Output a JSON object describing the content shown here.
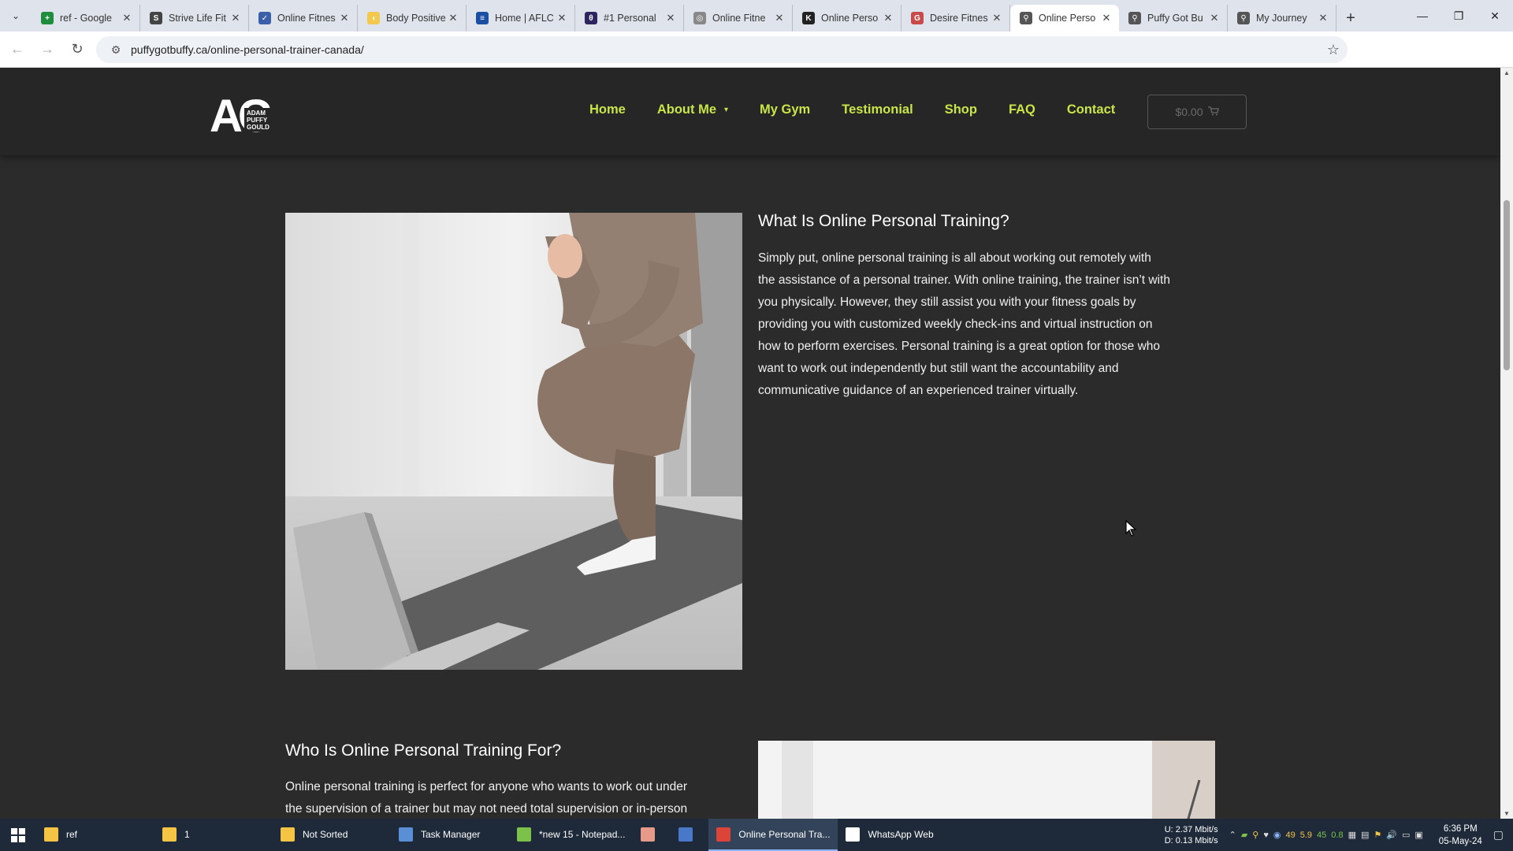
{
  "browser": {
    "tabs": [
      {
        "title": "ref - Google",
        "fav_color": "#1e8e3e",
        "fav_glyph": "+",
        "active": false
      },
      {
        "title": "Strive Life Fit",
        "fav_color": "#444444",
        "fav_glyph": "S",
        "active": false
      },
      {
        "title": "Online Fitnes",
        "fav_color": "#3b5fa8",
        "fav_glyph": "✓",
        "active": false
      },
      {
        "title": "Body Positive",
        "fav_color": "#f2c94c",
        "fav_glyph": "◖",
        "active": false
      },
      {
        "title": "Home | AFLC",
        "fav_color": "#1a4fa3",
        "fav_glyph": "≡",
        "active": false
      },
      {
        "title": "#1 Personal",
        "fav_color": "#2d2560",
        "fav_glyph": "θ",
        "active": false
      },
      {
        "title": "Online Fitne",
        "fav_color": "#888888",
        "fav_glyph": "◎",
        "active": false
      },
      {
        "title": "Online Perso",
        "fav_color": "#222222",
        "fav_glyph": "K",
        "active": false
      },
      {
        "title": "Desire Fitnes",
        "fav_color": "#c84a4a",
        "fav_glyph": "G",
        "active": false
      },
      {
        "title": "Online Perso",
        "fav_color": "#555555",
        "fav_glyph": "⚲",
        "active": true
      },
      {
        "title": "Puffy Got Bu",
        "fav_color": "#555555",
        "fav_glyph": "⚲",
        "active": false
      },
      {
        "title": "My Journey",
        "fav_color": "#555555",
        "fav_glyph": "⚲",
        "active": false
      }
    ],
    "url": "puffygotbuffy.ca/online-personal-trainer-canada/"
  },
  "site": {
    "logo": {
      "big": "AG",
      "line1": "ADAM",
      "line2": "PUFFY",
      "line3": "GOULD"
    },
    "nav": [
      {
        "label": "Home",
        "has_dropdown": false
      },
      {
        "label": "About Me",
        "has_dropdown": true
      },
      {
        "label": "My Gym",
        "has_dropdown": false
      },
      {
        "label": "Testimonial",
        "has_dropdown": false
      },
      {
        "label": "Shop",
        "has_dropdown": false
      },
      {
        "label": "FAQ",
        "has_dropdown": false
      },
      {
        "label": "Contact",
        "has_dropdown": false
      }
    ],
    "cart_label": "$0.00",
    "accent": "#c8e645"
  },
  "section1": {
    "heading": "What Is Online Personal Training?",
    "lines": [
      "Simply put, online personal training is all about working out remotely with",
      "the assistance of a personal trainer. With online training, the trainer isn’t with",
      "you physically. However, they still assist you with your fitness goals by",
      "providing you with customized weekly check-ins and virtual instruction on",
      "how to perform exercises. Personal training is a great option for those who",
      "want to work out independently but still want the accountability and",
      "communicative guidance of an experienced trainer virtually."
    ]
  },
  "section2": {
    "heading": "Who Is Online Personal Training For?",
    "lines": [
      "Online personal training is perfect for anyone who wants to work out under",
      "the supervision of a trainer but may not need total supervision or in-person"
    ]
  },
  "taskbar": {
    "items": [
      {
        "label": "ref",
        "ico_color": "#f6c445",
        "active": false
      },
      {
        "label": "1",
        "ico_color": "#f6c445",
        "active": false
      },
      {
        "label": "Not Sorted",
        "ico_color": "#f6c445",
        "active": false
      },
      {
        "label": "Task Manager",
        "ico_color": "#5a8fd6",
        "active": false
      },
      {
        "label": "*new 15 - Notepad...",
        "ico_color": "#7cc24a",
        "active": false
      },
      {
        "label": "",
        "ico_color": "#e89a8a",
        "active": false
      },
      {
        "label": "",
        "ico_color": "#4a78c8",
        "active": false
      },
      {
        "label": "Online Personal Tra...",
        "ico_color": "#db4437",
        "active": true
      },
      {
        "label": "WhatsApp Web",
        "ico_color": "#ffffff",
        "active": false
      }
    ],
    "net_up": "2.37 Mbit/s",
    "net_down": "0.13 Mbit/s",
    "net_up_label": "U:",
    "net_down_label": "D:",
    "sys_values": [
      "49",
      "5.9",
      "45",
      "0.8"
    ],
    "time": "6:36 PM",
    "date": "05-May-24"
  }
}
